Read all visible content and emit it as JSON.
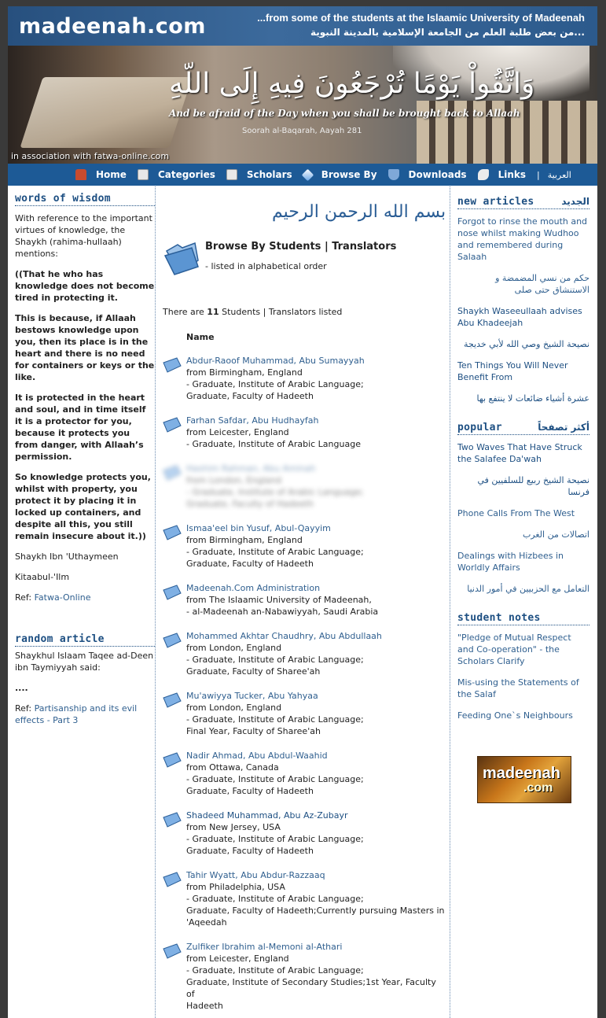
{
  "header": {
    "logo": "madeenah.com",
    "tagline_en": "...from some of the students at the Islaamic University of Madeenah",
    "tagline_ar": "...من بعض طلبة العلم من الجامعة الإسلامية بالمدينة النبوية",
    "verse_ar": "وَاتَّقُواْ يَوْمًا تُرْجَعُونَ فِيهِ إِلَى اللّهِ",
    "verse_en": "And be afraid of the Day when you shall be brought back to Allaah",
    "verse_ref": "Soorah al-Baqarah, Aayah 281",
    "association": "in association with fatwa-online.com"
  },
  "nav": {
    "items": [
      {
        "label": "Home",
        "icon": "home-icon"
      },
      {
        "label": "Categories",
        "icon": "document-icon"
      },
      {
        "label": "Scholars",
        "icon": "document-icon"
      },
      {
        "label": "Browse By",
        "icon": "gem-icon"
      },
      {
        "label": "Downloads",
        "icon": "shield-icon"
      },
      {
        "label": "Links",
        "icon": "tag-icon"
      }
    ],
    "separator": "|",
    "arabic_link": "العربية"
  },
  "left": {
    "wisdom_title": "words of wisdom",
    "wisdom_intro": "With reference to the important virtues of knowledge, the Shaykh (rahima-hullaah) mentions:",
    "wisdom_p1": "((That he who has knowledge does not become tired in protecting it.",
    "wisdom_p2": "This is because, if Allaah bestows knowledge upon you, then its place is in the heart and there is no need for containers or keys or the like.",
    "wisdom_p3": "It is protected in the heart and soul, and in time itself it is a protector for you, because it protects you from danger, with Allaah’s permission.",
    "wisdom_p4": "So knowledge protects you, whilst with property, you protect it by placing it in locked up containers, and despite all this, you still remain insecure about it.))",
    "wisdom_author": "Shaykh Ibn 'Uthaymeen",
    "wisdom_book": "Kitaabul-'Ilm",
    "wisdom_ref_label": "Ref: ",
    "wisdom_ref_link": "Fatwa-Online",
    "random_title": "random article",
    "random_intro": "Shaykhul Islaam Taqee ad-Deen ibn Taymiyyah said:",
    "random_quote": "....",
    "random_ref_label": "Ref: ",
    "random_ref_link": "Partisanship and its evil effects - Part 3"
  },
  "center": {
    "bismillah": "بسم الله الرحمن الرحيم",
    "title": "Browse By Students | Translators",
    "subtitle": "- listed in alphabetical order",
    "count_prefix": "There are ",
    "count": "11",
    "count_suffix": " Students | Translators listed",
    "column_header": "Name",
    "entries": [
      {
        "name": "Abdur-Raoof Muhammad, Abu Sumayyah",
        "lines": [
          "from Birmingham, England",
          "- Graduate, Institute of Arabic Language;",
          "Graduate, Faculty of Hadeeth"
        ]
      },
      {
        "name": "Farhan Safdar, Abu Hudhayfah",
        "lines": [
          "from Leicester, England",
          "- Graduate, Institute of Arabic Language"
        ]
      },
      {
        "name": "Hashim Rahman, Abu Aminah",
        "lines": [
          "from London, England",
          "- Graduate, Institute of Arabic Language;",
          "Graduate, Faculty of Hadeeth"
        ]
      },
      {
        "name": "Ismaa'eel bin Yusuf, Abul-Qayyim",
        "lines": [
          "from Birmingham, England",
          "- Graduate, Institute of Arabic Language;",
          "Graduate, Faculty of Hadeeth"
        ]
      },
      {
        "name": "Madeenah.Com Administration",
        "lines": [
          "from The Islaamic University of Madeenah,",
          "- al-Madeenah an-Nabawiyyah, Saudi Arabia"
        ]
      },
      {
        "name": "Mohammed Akhtar Chaudhry, Abu Abdullaah",
        "lines": [
          "from London, England",
          "- Graduate, Institute of Arabic Language;",
          "Graduate, Faculty of Sharee'ah"
        ]
      },
      {
        "name": "Mu'awiyya Tucker, Abu Yahyaa",
        "lines": [
          "from London, England",
          "- Graduate, Institute of Arabic Language;",
          "Final Year, Faculty of Sharee'ah"
        ]
      },
      {
        "name": "Nadir Ahmad, Abu Abdul-Waahid",
        "lines": [
          "from Ottawa, Canada",
          "- Graduate, Institute of Arabic Language;",
          "Graduate, Faculty of Hadeeth"
        ]
      },
      {
        "name": "Shadeed Muhammad, Abu Az-Zubayr",
        "lines": [
          "from New Jersey, USA",
          "- Graduate, Institute of Arabic Language;",
          "Graduate, Faculty of Hadeeth"
        ]
      },
      {
        "name": "Tahir Wyatt, Abu Abdur-Razzaaq",
        "lines": [
          "from Philadelphia, USA",
          "- Graduate, Institute of Arabic Language;",
          "Graduate, Faculty of Hadeeth;Currently pursuing Masters in",
          "'Aqeedah"
        ]
      },
      {
        "name": "Zulfiker Ibrahim al-Memoni al-Athari",
        "lines": [
          "from Leicester, England",
          "- Graduate, Institute of Arabic Language;",
          "Graduate, Institute of Secondary Studies;1st Year, Faculty of",
          "Hadeeth"
        ]
      }
    ]
  },
  "right": {
    "new_title": "new articles",
    "new_title_ar": "الجديد",
    "new_items": [
      {
        "text": "Forgot to rinse the mouth and nose whilst making Wudhoo and remembered during Salaah",
        "ar": false
      },
      {
        "text": "حكم من نسي المضمضة و الاستنشاق حتى صلى",
        "ar": true
      },
      {
        "text": "Shaykh Waseeullaah advises Abu Khadeejah",
        "ar": false
      },
      {
        "text": "نصيحة الشيخ وصي الله لأبي خديجة",
        "ar": true
      },
      {
        "text": "Ten Things You Will Never Benefit From",
        "ar": false
      },
      {
        "text": "عشرة أشياء ضائعات لا ينتفع بها",
        "ar": true
      }
    ],
    "popular_title": "popular",
    "popular_title_ar": "أكثر تصفحاً",
    "popular_items": [
      {
        "text": "Two Waves That Have Struck the Salafee Da'wah",
        "ar": false
      },
      {
        "text": "نصيحة الشيخ ربيع للسلفيين في فرنسا",
        "ar": true
      },
      {
        "text": "Phone Calls From The West",
        "ar": false
      },
      {
        "text": "اتصالات من الغرب",
        "ar": true
      },
      {
        "text": "Dealings with Hizbees in Worldly Affairs",
        "ar": false
      },
      {
        "text": "التعامل مع الحزبيين في أمور الدنيا",
        "ar": true
      }
    ],
    "notes_title": "student notes",
    "notes_items": [
      {
        "text": "\"Pledge of Mutual Respect and Co-operation\" - the Scholars Clarify"
      },
      {
        "text": "Mis-using the Statements of the Salaf"
      },
      {
        "text": "Feeding One`s Neighbours"
      }
    ],
    "badge_logo": "madeenah",
    "badge_logo_com": ".com"
  },
  "colors": {
    "nav_bg": "#1d5a96",
    "link": "#2f5f8f",
    "heading": "#1d4f82",
    "page_bg": "#3a3a3a"
  }
}
